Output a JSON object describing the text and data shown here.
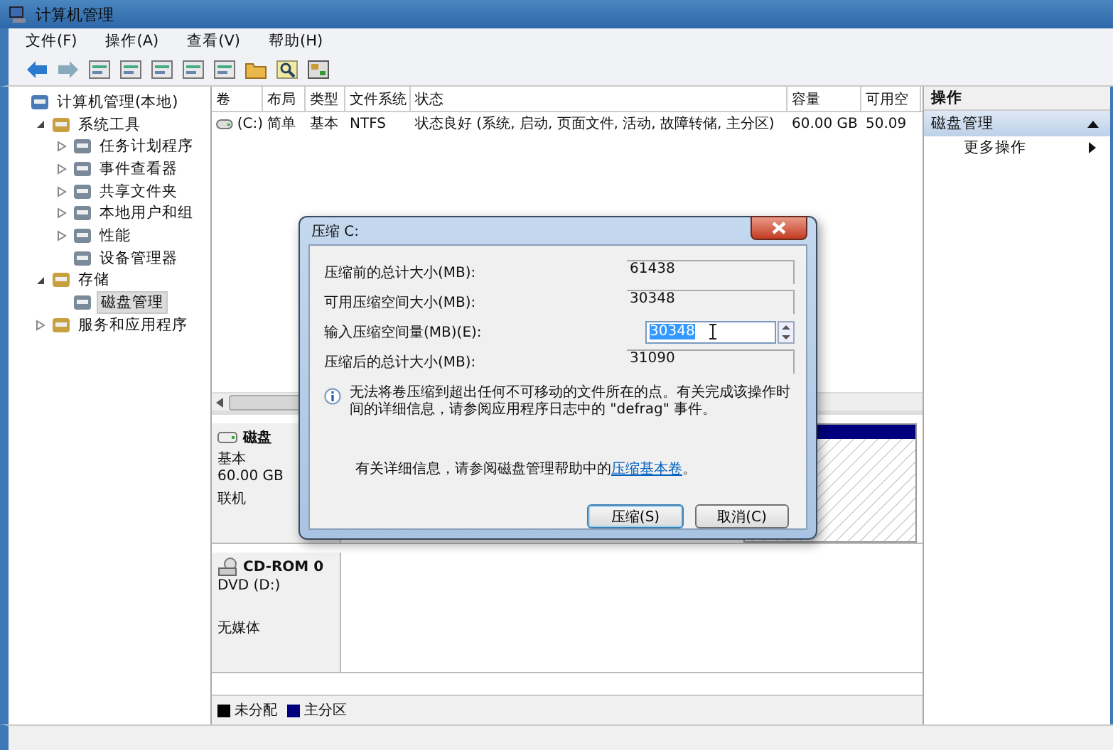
{
  "window": {
    "title": "计算机管理"
  },
  "menu": [
    "文件(F)",
    "操作(A)",
    "查看(V)",
    "帮助(H)"
  ],
  "tree": [
    {
      "label": "计算机管理(本地)",
      "selected": false,
      "children": [
        {
          "label": "系统工具",
          "expanded": true,
          "selected": false,
          "children": [
            {
              "label": "任务计划程序",
              "expanded": false,
              "selected": false
            },
            {
              "label": "事件查看器",
              "expanded": false,
              "selected": false
            },
            {
              "label": "共享文件夹",
              "expanded": false,
              "selected": false
            },
            {
              "label": "本地用户和组",
              "expanded": false,
              "selected": false
            },
            {
              "label": "性能",
              "expanded": false,
              "selected": false
            },
            {
              "label": "设备管理器",
              "selected": false
            }
          ]
        },
        {
          "label": "存储",
          "expanded": true,
          "selected": false,
          "children": [
            {
              "label": "磁盘管理",
              "selected": true
            }
          ]
        },
        {
          "label": "服务和应用程序",
          "expanded": false,
          "selected": false
        }
      ]
    }
  ],
  "volumes": {
    "columns": [
      "卷",
      "布局",
      "类型",
      "文件系统",
      "状态",
      "容量",
      "可用空"
    ],
    "rows": [
      [
        "(C:)",
        "简单",
        "基本",
        "NTFS",
        "状态良好 (系统, 启动, 页面文件, 活动, 故障转储, 主分区)",
        "60.00 GB",
        "50.09"
      ]
    ]
  },
  "disks": [
    {
      "kind": "disk",
      "name": "磁盘",
      "lines": [
        "基本",
        "60.00 GB",
        "联机"
      ]
    },
    {
      "kind": "cdrom",
      "name": "CD-ROM 0",
      "lines": [
        "DVD (D:)",
        "无媒体"
      ]
    }
  ],
  "legend": [
    {
      "label": "未分配",
      "color": "#000000"
    },
    {
      "label": "主分区",
      "color": "#00007f"
    }
  ],
  "actions": {
    "header": "操作",
    "section": "磁盘管理",
    "items": [
      "更多操作"
    ]
  },
  "dialog": {
    "title": "压缩 C:",
    "fields": [
      {
        "label": "压缩前的总计大小(MB):",
        "value": "61438",
        "kind": "readonly"
      },
      {
        "label": "可用压缩空间大小(MB):",
        "value": "30348",
        "kind": "readonly"
      },
      {
        "label": "输入压缩空间量(MB)(E):",
        "value": "30348",
        "kind": "spin"
      },
      {
        "label": "压缩后的总计大小(MB):",
        "value": "31090",
        "kind": "readonly"
      }
    ],
    "info": "无法将卷压缩到超出任何不可移动的文件所在的点。有关完成该操作时间的详细信息，请参阅应用程序日志中的 \"defrag\" 事件。",
    "help": "有关详细信息，请参阅磁盘管理帮助中的",
    "help_link": "压缩基本卷",
    "help_end": "。",
    "buttons": [
      {
        "label": "压缩(S)",
        "default": true
      },
      {
        "label": "取消(C)",
        "default": false
      }
    ]
  }
}
